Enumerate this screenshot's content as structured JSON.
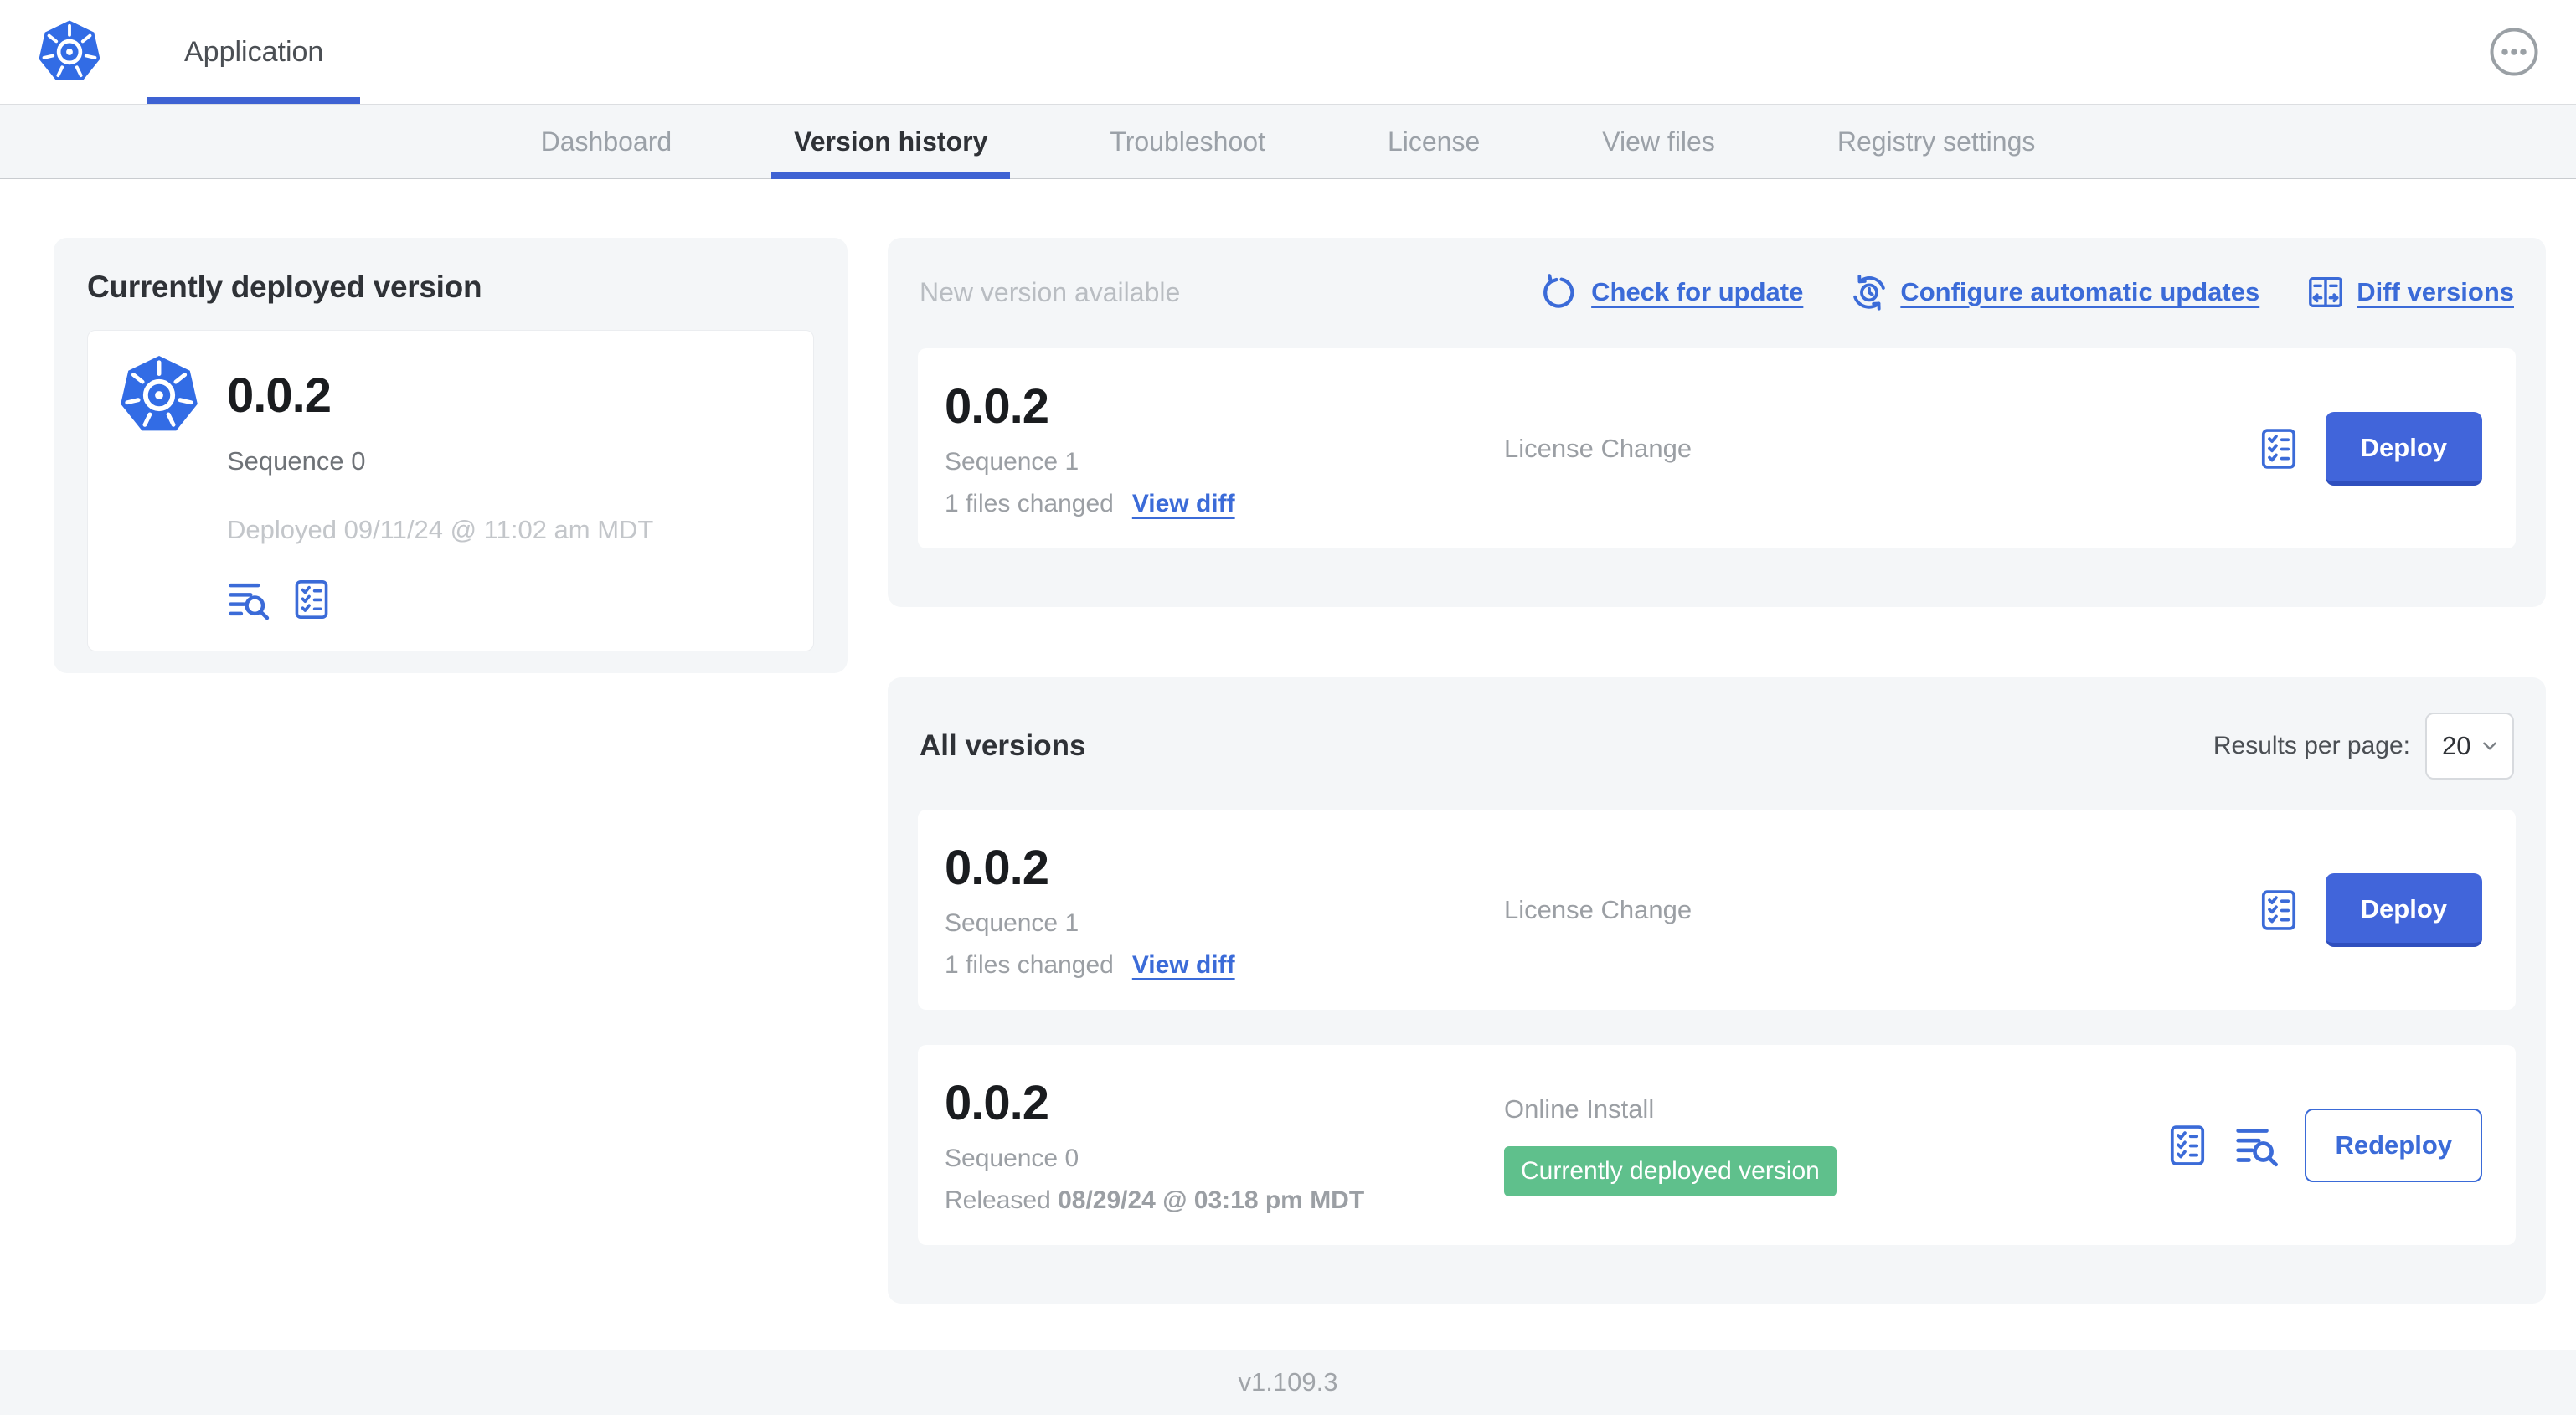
{
  "header": {
    "app_tab_label": "Application"
  },
  "nav": {
    "tabs": [
      {
        "label": "Dashboard"
      },
      {
        "label": "Version history"
      },
      {
        "label": "Troubleshoot"
      },
      {
        "label": "License"
      },
      {
        "label": "View files"
      },
      {
        "label": "Registry settings"
      }
    ],
    "active_tab": "Version history"
  },
  "current_version": {
    "title": "Currently deployed version",
    "version": "0.0.2",
    "sequence": "Sequence 0",
    "deployed": "Deployed 09/11/24 @ 11:02 am MDT",
    "icons": [
      "logs-icon",
      "checklist-icon"
    ]
  },
  "new_version": {
    "title": "New version available",
    "check_link": "Check for update",
    "configure_link": "Configure automatic updates",
    "diff_link": "Diff versions",
    "row": {
      "version": "0.0.2",
      "sequence": "Sequence 1",
      "files_changed": "1 files changed",
      "view_diff": "View diff",
      "source": "License Change",
      "action": "Deploy"
    }
  },
  "all_versions": {
    "title": "All versions",
    "results_label": "Results per page:",
    "results_value": "20",
    "rows": [
      {
        "version": "0.0.2",
        "sequence": "Sequence 1",
        "files_changed": "1 files changed",
        "view_diff": "View diff",
        "source": "License Change",
        "action": "Deploy"
      },
      {
        "version": "0.0.2",
        "sequence": "Sequence 0",
        "released_prefix": "Released ",
        "released_date": "08/29/24 @ 03:18 pm MDT",
        "source": "Online Install",
        "badge": "Currently deployed version",
        "action": "Redeploy"
      }
    ]
  },
  "footer": {
    "version": "v1.109.3"
  },
  "colors": {
    "accent_blue": "#3b6bd8",
    "button_blue": "#4165da",
    "k8s_logo_blue": "#326CE5",
    "badge_green": "#5fc08c",
    "card_background": "#f4f6f8"
  }
}
